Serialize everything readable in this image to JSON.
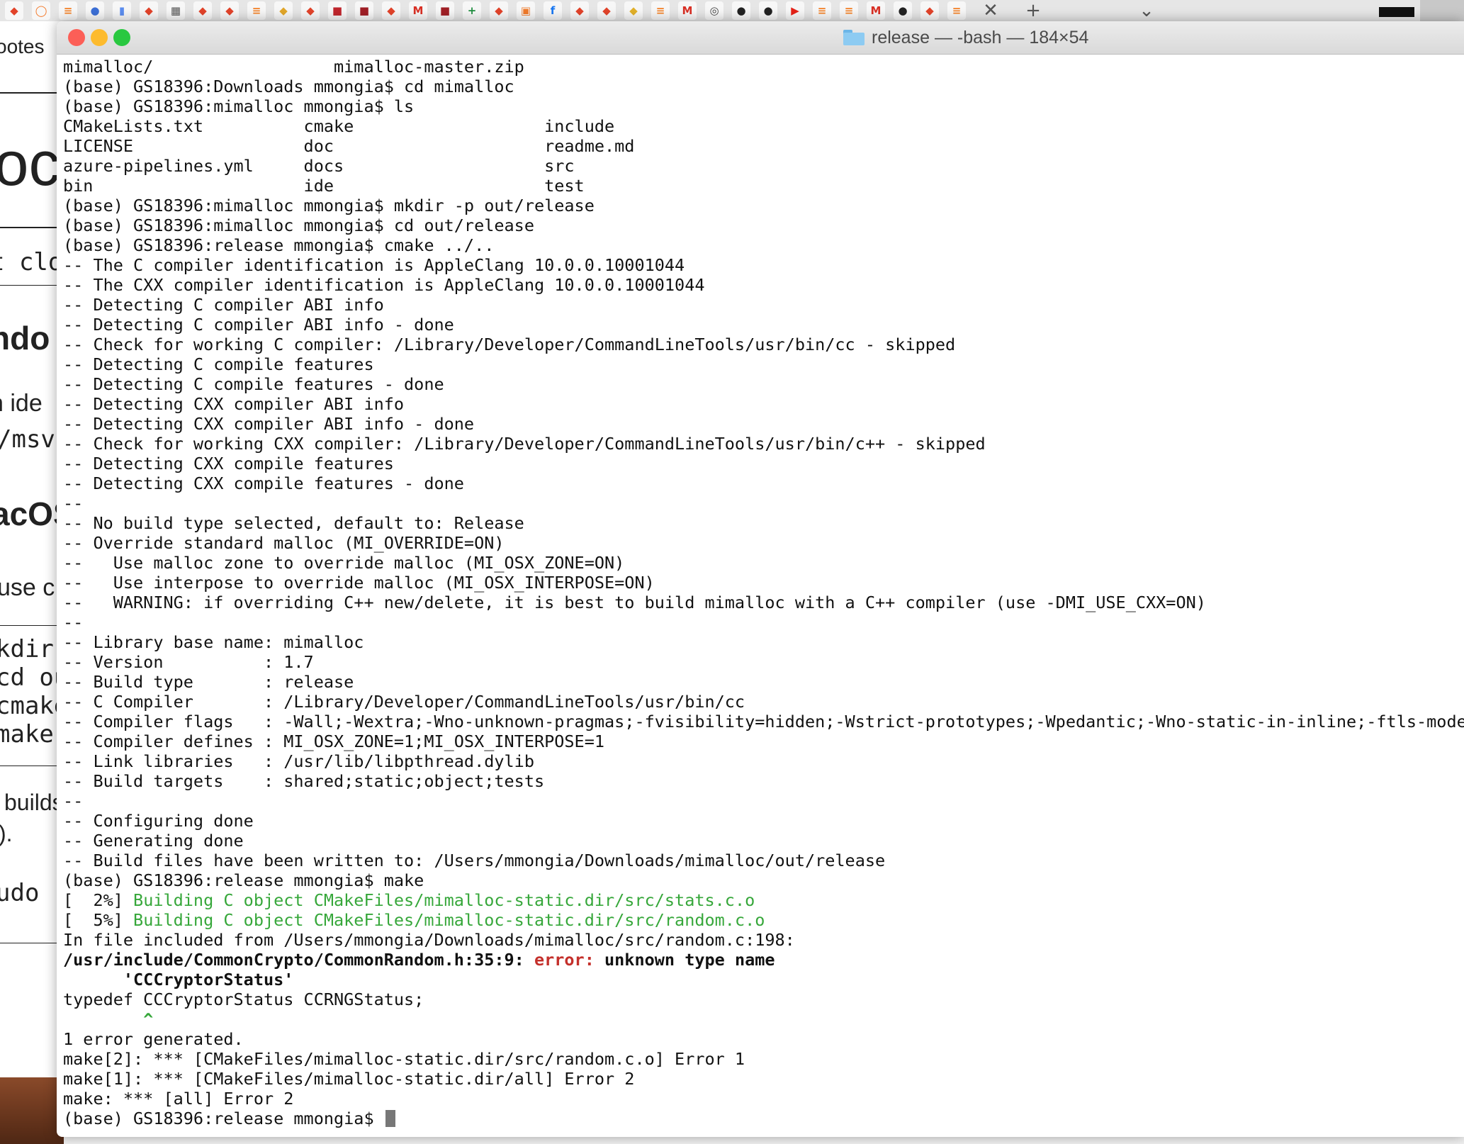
{
  "browser": {
    "tab_icons": [
      {
        "name": "gitlab-icon",
        "glyph": "◆",
        "color": "#e2432a"
      },
      {
        "name": "jupyter-icon",
        "glyph": "◯",
        "color": "#f37726"
      },
      {
        "name": "stack-icon",
        "glyph": "≡",
        "color": "#f48024"
      },
      {
        "name": "chrome-icon",
        "glyph": "●",
        "color": "#3c6fd6"
      },
      {
        "name": "chart-icon",
        "glyph": "▮",
        "color": "#5b8def"
      },
      {
        "name": "gitlab-icon",
        "glyph": "◆",
        "color": "#e2432a"
      },
      {
        "name": "grid-icon",
        "glyph": "▦",
        "color": "#555555"
      },
      {
        "name": "gitlab-icon",
        "glyph": "◆",
        "color": "#e2432a"
      },
      {
        "name": "gitlab-icon",
        "glyph": "◆",
        "color": "#e2432a"
      },
      {
        "name": "stackoverflow-icon",
        "glyph": "≡",
        "color": "#f48024"
      },
      {
        "name": "gitlab-icon",
        "glyph": "◆",
        "color": "#e2a72a"
      },
      {
        "name": "gitlab-icon",
        "glyph": "◆",
        "color": "#e2432a"
      },
      {
        "name": "red-app-icon",
        "glyph": "■",
        "color": "#c0262d"
      },
      {
        "name": "red-app-icon",
        "glyph": "■",
        "color": "#a01f26"
      },
      {
        "name": "gitlab-icon",
        "glyph": "◆",
        "color": "#e2432a"
      },
      {
        "name": "gmail-icon",
        "glyph": "M",
        "color": "#d93025"
      },
      {
        "name": "red-app-icon",
        "glyph": "■",
        "color": "#a01f26"
      },
      {
        "name": "sheets-icon",
        "glyph": "+",
        "color": "#1e8e3e"
      },
      {
        "name": "gitlab-icon",
        "glyph": "◆",
        "color": "#e2432a"
      },
      {
        "name": "box-icon",
        "glyph": "▣",
        "color": "#f07a2a"
      },
      {
        "name": "facebook-icon",
        "glyph": "f",
        "color": "#1877f2"
      },
      {
        "name": "gitlab-icon",
        "glyph": "◆",
        "color": "#e2432a"
      },
      {
        "name": "gitlab-icon",
        "glyph": "◆",
        "color": "#e2432a"
      },
      {
        "name": "shield-icon",
        "glyph": "◆",
        "color": "#e2b12a"
      },
      {
        "name": "stackoverflow-icon",
        "glyph": "≡",
        "color": "#f48024"
      },
      {
        "name": "gmail-icon",
        "glyph": "M",
        "color": "#d93025"
      },
      {
        "name": "globe-icon",
        "glyph": "◎",
        "color": "#444444"
      },
      {
        "name": "github-icon",
        "glyph": "●",
        "color": "#222222"
      },
      {
        "name": "github-icon",
        "glyph": "●",
        "color": "#222222"
      },
      {
        "name": "youtube-icon",
        "glyph": "▶",
        "color": "#e62117"
      },
      {
        "name": "stackoverflow-icon",
        "glyph": "≡",
        "color": "#f48024"
      },
      {
        "name": "stackoverflow-icon",
        "glyph": "≡",
        "color": "#f48024"
      },
      {
        "name": "gmail-icon",
        "glyph": "M",
        "color": "#d93025"
      },
      {
        "name": "github-icon",
        "glyph": "●",
        "color": "#222222"
      },
      {
        "name": "gitlab-icon",
        "glyph": "◆",
        "color": "#e2432a"
      },
      {
        "name": "stackoverflow-icon",
        "glyph": "≡",
        "color": "#f48024"
      }
    ],
    "close_glyph": "✕",
    "new_tab_glyph": "+",
    "dropdown_glyph": "⌄"
  },
  "background_page": {
    "fragments": [
      "ootes",
      "loc",
      "t clo",
      "ndo",
      "n ide",
      "/msv",
      "acOS",
      "use c",
      "kdir",
      "cd ou",
      "cmake",
      "make",
      "builds",
      ").",
      "udo"
    ]
  },
  "terminal": {
    "title": "release — -bash — 184×54",
    "colors": {
      "close": "#fc5f57",
      "minimize": "#fdbb2e",
      "zoom": "#29c840",
      "green": "#36a73a",
      "error": "#c4302b"
    },
    "lines": [
      [
        {
          "t": "mimalloc/                  mimalloc-master.zip"
        }
      ],
      [
        {
          "t": "(base) GS18396:Downloads mmongia$ cd mimalloc"
        }
      ],
      [
        {
          "t": "(base) GS18396:mimalloc mmongia$ ls"
        }
      ],
      [
        {
          "t": "CMakeLists.txt          cmake                   include"
        }
      ],
      [
        {
          "t": "LICENSE                 doc                     readme.md"
        }
      ],
      [
        {
          "t": "azure-pipelines.yml     docs                    src"
        }
      ],
      [
        {
          "t": "bin                     ide                     test"
        }
      ],
      [
        {
          "t": "(base) GS18396:mimalloc mmongia$ mkdir -p out/release"
        }
      ],
      [
        {
          "t": "(base) GS18396:mimalloc mmongia$ cd out/release"
        }
      ],
      [
        {
          "t": "(base) GS18396:release mmongia$ cmake ../.."
        }
      ],
      [
        {
          "t": "-- The C compiler identification is AppleClang 10.0.0.10001044"
        }
      ],
      [
        {
          "t": "-- The CXX compiler identification is AppleClang 10.0.0.10001044"
        }
      ],
      [
        {
          "t": "-- Detecting C compiler ABI info"
        }
      ],
      [
        {
          "t": "-- Detecting C compiler ABI info - done"
        }
      ],
      [
        {
          "t": "-- Check for working C compiler: /Library/Developer/CommandLineTools/usr/bin/cc - skipped"
        }
      ],
      [
        {
          "t": "-- Detecting C compile features"
        }
      ],
      [
        {
          "t": "-- Detecting C compile features - done"
        }
      ],
      [
        {
          "t": "-- Detecting CXX compiler ABI info"
        }
      ],
      [
        {
          "t": "-- Detecting CXX compiler ABI info - done"
        }
      ],
      [
        {
          "t": "-- Check for working CXX compiler: /Library/Developer/CommandLineTools/usr/bin/c++ - skipped"
        }
      ],
      [
        {
          "t": "-- Detecting CXX compile features"
        }
      ],
      [
        {
          "t": "-- Detecting CXX compile features - done"
        }
      ],
      [
        {
          "t": "--"
        }
      ],
      [
        {
          "t": "-- No build type selected, default to: Release"
        }
      ],
      [
        {
          "t": "-- Override standard malloc (MI_OVERRIDE=ON)"
        }
      ],
      [
        {
          "t": "--   Use malloc zone to override malloc (MI_OSX_ZONE=ON)"
        }
      ],
      [
        {
          "t": "--   Use interpose to override malloc (MI_OSX_INTERPOSE=ON)"
        }
      ],
      [
        {
          "t": "--   WARNING: if overriding C++ new/delete, it is best to build mimalloc with a C++ compiler (use -DMI_USE_CXX=ON)"
        }
      ],
      [
        {
          "t": "--"
        }
      ],
      [
        {
          "t": "-- Library base name: mimalloc"
        }
      ],
      [
        {
          "t": "-- Version          : 1.7"
        }
      ],
      [
        {
          "t": "-- Build type       : release"
        }
      ],
      [
        {
          "t": "-- C Compiler       : /Library/Developer/CommandLineTools/usr/bin/cc"
        }
      ],
      [
        {
          "t": "-- Compiler flags   : -Wall;-Wextra;-Wno-unknown-pragmas;-fvisibility=hidden;-Wstrict-prototypes;-Wpedantic;-Wno-static-in-inline;-ftls-model="
        }
      ],
      [
        {
          "t": "-- Compiler defines : MI_OSX_ZONE=1;MI_OSX_INTERPOSE=1"
        }
      ],
      [
        {
          "t": "-- Link libraries   : /usr/lib/libpthread.dylib"
        }
      ],
      [
        {
          "t": "-- Build targets    : shared;static;object;tests"
        }
      ],
      [
        {
          "t": "--"
        }
      ],
      [
        {
          "t": "-- Configuring done"
        }
      ],
      [
        {
          "t": "-- Generating done"
        }
      ],
      [
        {
          "t": "-- Build files have been written to: /Users/mmongia/Downloads/mimalloc/out/release"
        }
      ],
      [
        {
          "t": "(base) GS18396:release mmongia$ make"
        }
      ],
      [
        {
          "t": "[  2%] "
        },
        {
          "t": "Building C object CMakeFiles/mimalloc-static.dir/src/stats.c.o",
          "c": "green"
        }
      ],
      [
        {
          "t": "[  5%] "
        },
        {
          "t": "Building C object CMakeFiles/mimalloc-static.dir/src/random.c.o",
          "c": "green"
        }
      ],
      [
        {
          "t": "In file included from /Users/mmongia/Downloads/mimalloc/src/random.c:198:"
        }
      ],
      [
        {
          "t": "/usr/include/CommonCrypto/CommonRandom.h:35:9: ",
          "c": "bold"
        },
        {
          "t": "error: ",
          "c": "err"
        },
        {
          "t": "unknown type name",
          "c": "bold"
        }
      ],
      [
        {
          "t": "      'CCCryptorStatus'",
          "c": "bold"
        }
      ],
      [
        {
          "t": "typedef CCCryptorStatus CCRNGStatus;"
        }
      ],
      [
        {
          "t": "        ^",
          "c": "green bold"
        }
      ],
      [
        {
          "t": "1 error generated."
        }
      ],
      [
        {
          "t": "make[2]: *** [CMakeFiles/mimalloc-static.dir/src/random.c.o] Error 1"
        }
      ],
      [
        {
          "t": "make[1]: *** [CMakeFiles/mimalloc-static.dir/all] Error 2"
        }
      ],
      [
        {
          "t": "make: *** [all] Error 2"
        }
      ],
      [
        {
          "t": "(base) GS18396:release mmongia$ "
        }
      ]
    ]
  }
}
